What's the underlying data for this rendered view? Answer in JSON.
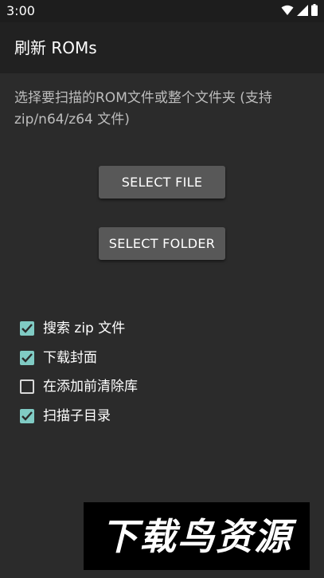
{
  "status_bar": {
    "time": "3:00"
  },
  "app_bar": {
    "title": "刷新 ROMs"
  },
  "description": "选择要扫描的ROM文件或整个文件夹 (支持zip/n64/z64 文件)",
  "buttons": {
    "select_file": "SELECT FILE",
    "select_folder": "SELECT FOLDER"
  },
  "options": [
    {
      "label": "搜索 zip 文件",
      "checked": true
    },
    {
      "label": "下载封面",
      "checked": true
    },
    {
      "label": "在添加前清除库",
      "checked": false
    },
    {
      "label": "扫描子目录",
      "checked": true
    }
  ],
  "watermark": {
    "text": "下载鸟资源"
  },
  "colors": {
    "background": "#2b2b2b",
    "app_bar": "#212121",
    "status_bar": "#1d1d1d",
    "button": "#585858",
    "checkbox_accent": "#80cbc4"
  },
  "icons": {
    "status": [
      "wifi-icon",
      "cellular-signal-icon",
      "battery-icon"
    ],
    "checkbox_checked": "check-icon"
  }
}
